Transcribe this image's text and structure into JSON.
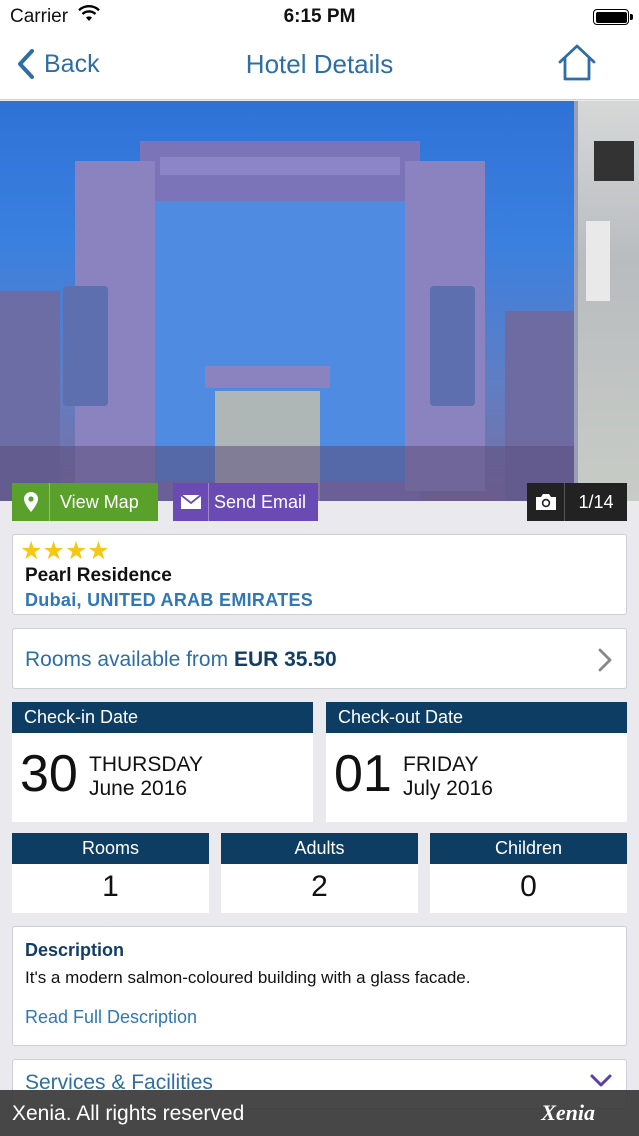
{
  "status_bar": {
    "carrier": "Carrier",
    "time": "6:15 PM"
  },
  "nav": {
    "back_label": "Back",
    "title": "Hotel Details"
  },
  "gallery": {
    "counter": "1/14",
    "view_map_label": "View Map",
    "send_email_label": "Send Email"
  },
  "hotel": {
    "stars": 4,
    "name": "Pearl Residence",
    "location": "Dubai, UNITED ARAB EMIRATES"
  },
  "rooms_available": {
    "prefix": "Rooms available from",
    "price": "EUR 35.50"
  },
  "checkin": {
    "label": "Check-in Date",
    "day": "30",
    "weekday": "THURSDAY",
    "month_year": "June 2016"
  },
  "checkout": {
    "label": "Check-out Date",
    "day": "01",
    "weekday": "FRIDAY",
    "month_year": "July 2016"
  },
  "occupancy": {
    "rooms_label": "Rooms",
    "rooms": "1",
    "adults_label": "Adults",
    "adults": "2",
    "children_label": "Children",
    "children": "0"
  },
  "description": {
    "heading": "Description",
    "text": "It's a modern salmon-coloured building with a glass facade.",
    "link": "Read Full Description"
  },
  "services": {
    "title": "Services & Facilities"
  },
  "footer": {
    "copyright": "Xenia. All rights reserved",
    "logo": "Xenia"
  },
  "colors": {
    "accent_blue": "#2f6ea3",
    "header_navy": "#0e3d63",
    "map_green": "#5aa12b",
    "email_purple": "#6a4bb3",
    "star_yellow": "#f4c912"
  },
  "icons": {
    "wifi": "wifi-icon",
    "battery": "battery-icon",
    "back": "chevron-left-icon",
    "home": "home-icon",
    "map": "map-pin-icon",
    "email": "envelope-icon",
    "camera": "camera-icon",
    "star": "star-icon",
    "rooms_arrow": "chevron-right-icon",
    "services_arrow": "chevron-down-icon"
  }
}
